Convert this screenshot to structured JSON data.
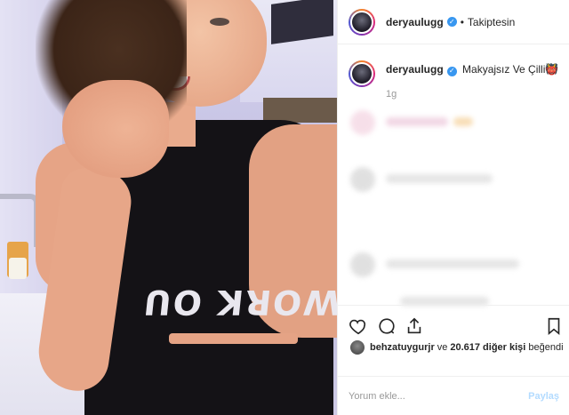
{
  "post": {
    "username": "deryaulugg",
    "follow_status": "Takiptesin",
    "separator": "•",
    "verified_glyph": "✓",
    "shirt_text": "WORK OU"
  },
  "caption": {
    "username": "deryaulugg",
    "text": "Makyajsız Ve Çilli",
    "emoji": "👹",
    "time": "1g"
  },
  "actions": {
    "icons": [
      "heart-icon",
      "comment-icon",
      "share-icon",
      "bookmark-icon"
    ]
  },
  "likes": {
    "user": "behzatuygurjr",
    "connector": "ve",
    "count": "20.617 diğer kişi",
    "suffix": "beğendi"
  },
  "comment": {
    "placeholder": "Yorum ekle...",
    "post_label": "Paylaş"
  },
  "colors": {
    "verified": "#3897f0",
    "post_disabled": "#b3dbff",
    "muted": "#999999"
  }
}
